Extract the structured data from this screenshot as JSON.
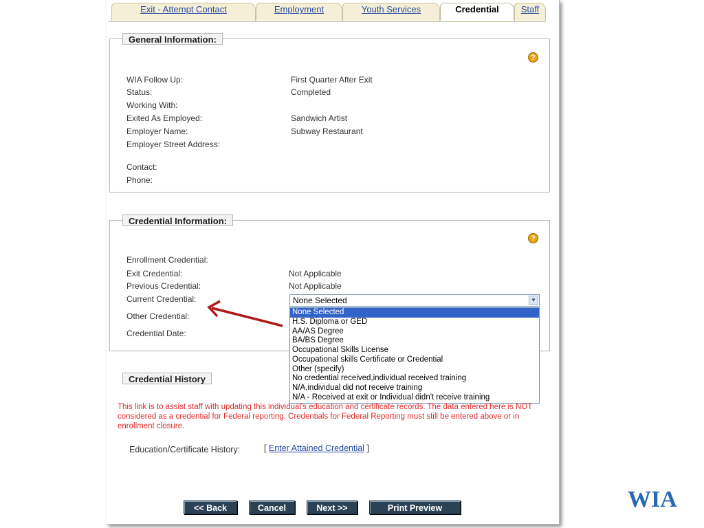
{
  "tabs": [
    {
      "label": "Exit - Attempt Contact"
    },
    {
      "label": "Employment"
    },
    {
      "label": "Youth Services"
    },
    {
      "label": "Credential"
    },
    {
      "label": "Staff"
    }
  ],
  "general": {
    "legend": "General Information:",
    "help_glyph": "?",
    "rows": [
      {
        "label": "WIA Follow Up:",
        "value": "First Quarter After Exit"
      },
      {
        "label": "Status:",
        "value": "Completed"
      },
      {
        "label": "Working With:",
        "value": ""
      },
      {
        "label": "Exited As Employed:",
        "value": "Sandwich Artist"
      },
      {
        "label": "Employer Name:",
        "value": "Subway Restaurant"
      },
      {
        "label": "Employer Street Address:",
        "value": ""
      },
      {
        "label": "Contact:",
        "value": ""
      },
      {
        "label": "Phone:",
        "value": ""
      }
    ]
  },
  "credential": {
    "legend": "Credential Information:",
    "help_glyph": "?",
    "rows": [
      {
        "label": "Enrollment Credential:",
        "value": ""
      },
      {
        "label": "Exit Credential:",
        "value": "Not Applicable"
      },
      {
        "label": "Previous Credential:",
        "value": "Not Applicable"
      },
      {
        "label": "Current Credential:",
        "value": ""
      },
      {
        "label": "Other Credential:",
        "value": ""
      },
      {
        "label": "Credential Date:",
        "value": ""
      }
    ],
    "select_value": "None Selected",
    "options": [
      "None Selected",
      "H.S. Diploma or GED",
      "AA/AS Degree",
      "BA/BS Degree",
      "Occupational Skills License",
      "Occupational skills Certificate or Credential",
      "Other (specify)",
      "No credential received,individual received training",
      "N/A,individual did not receive training",
      "N/A - Received at exit or Individual didn't receive training"
    ]
  },
  "history": {
    "legend": "Credential History",
    "note": "This link is to assist staff with updating this individual's education and certificate records. The data entered here is NOT considered as a credential for Federal reporting. Credentials for Federal Reporting must still be entered above or in enrollment closure.",
    "label": "Education/Certificate History:",
    "bracket_open": "[",
    "link": "Enter Attained Credential",
    "bracket_close": "]"
  },
  "buttons": {
    "back": "<< Back",
    "cancel": "Cancel",
    "next": "Next >>",
    "print": "Print Preview"
  },
  "logo": "WIA",
  "colors": {
    "arrow": "#b01818",
    "logo": "#2a68b0",
    "selected": "#3163c8",
    "note": "#e02a2a"
  }
}
